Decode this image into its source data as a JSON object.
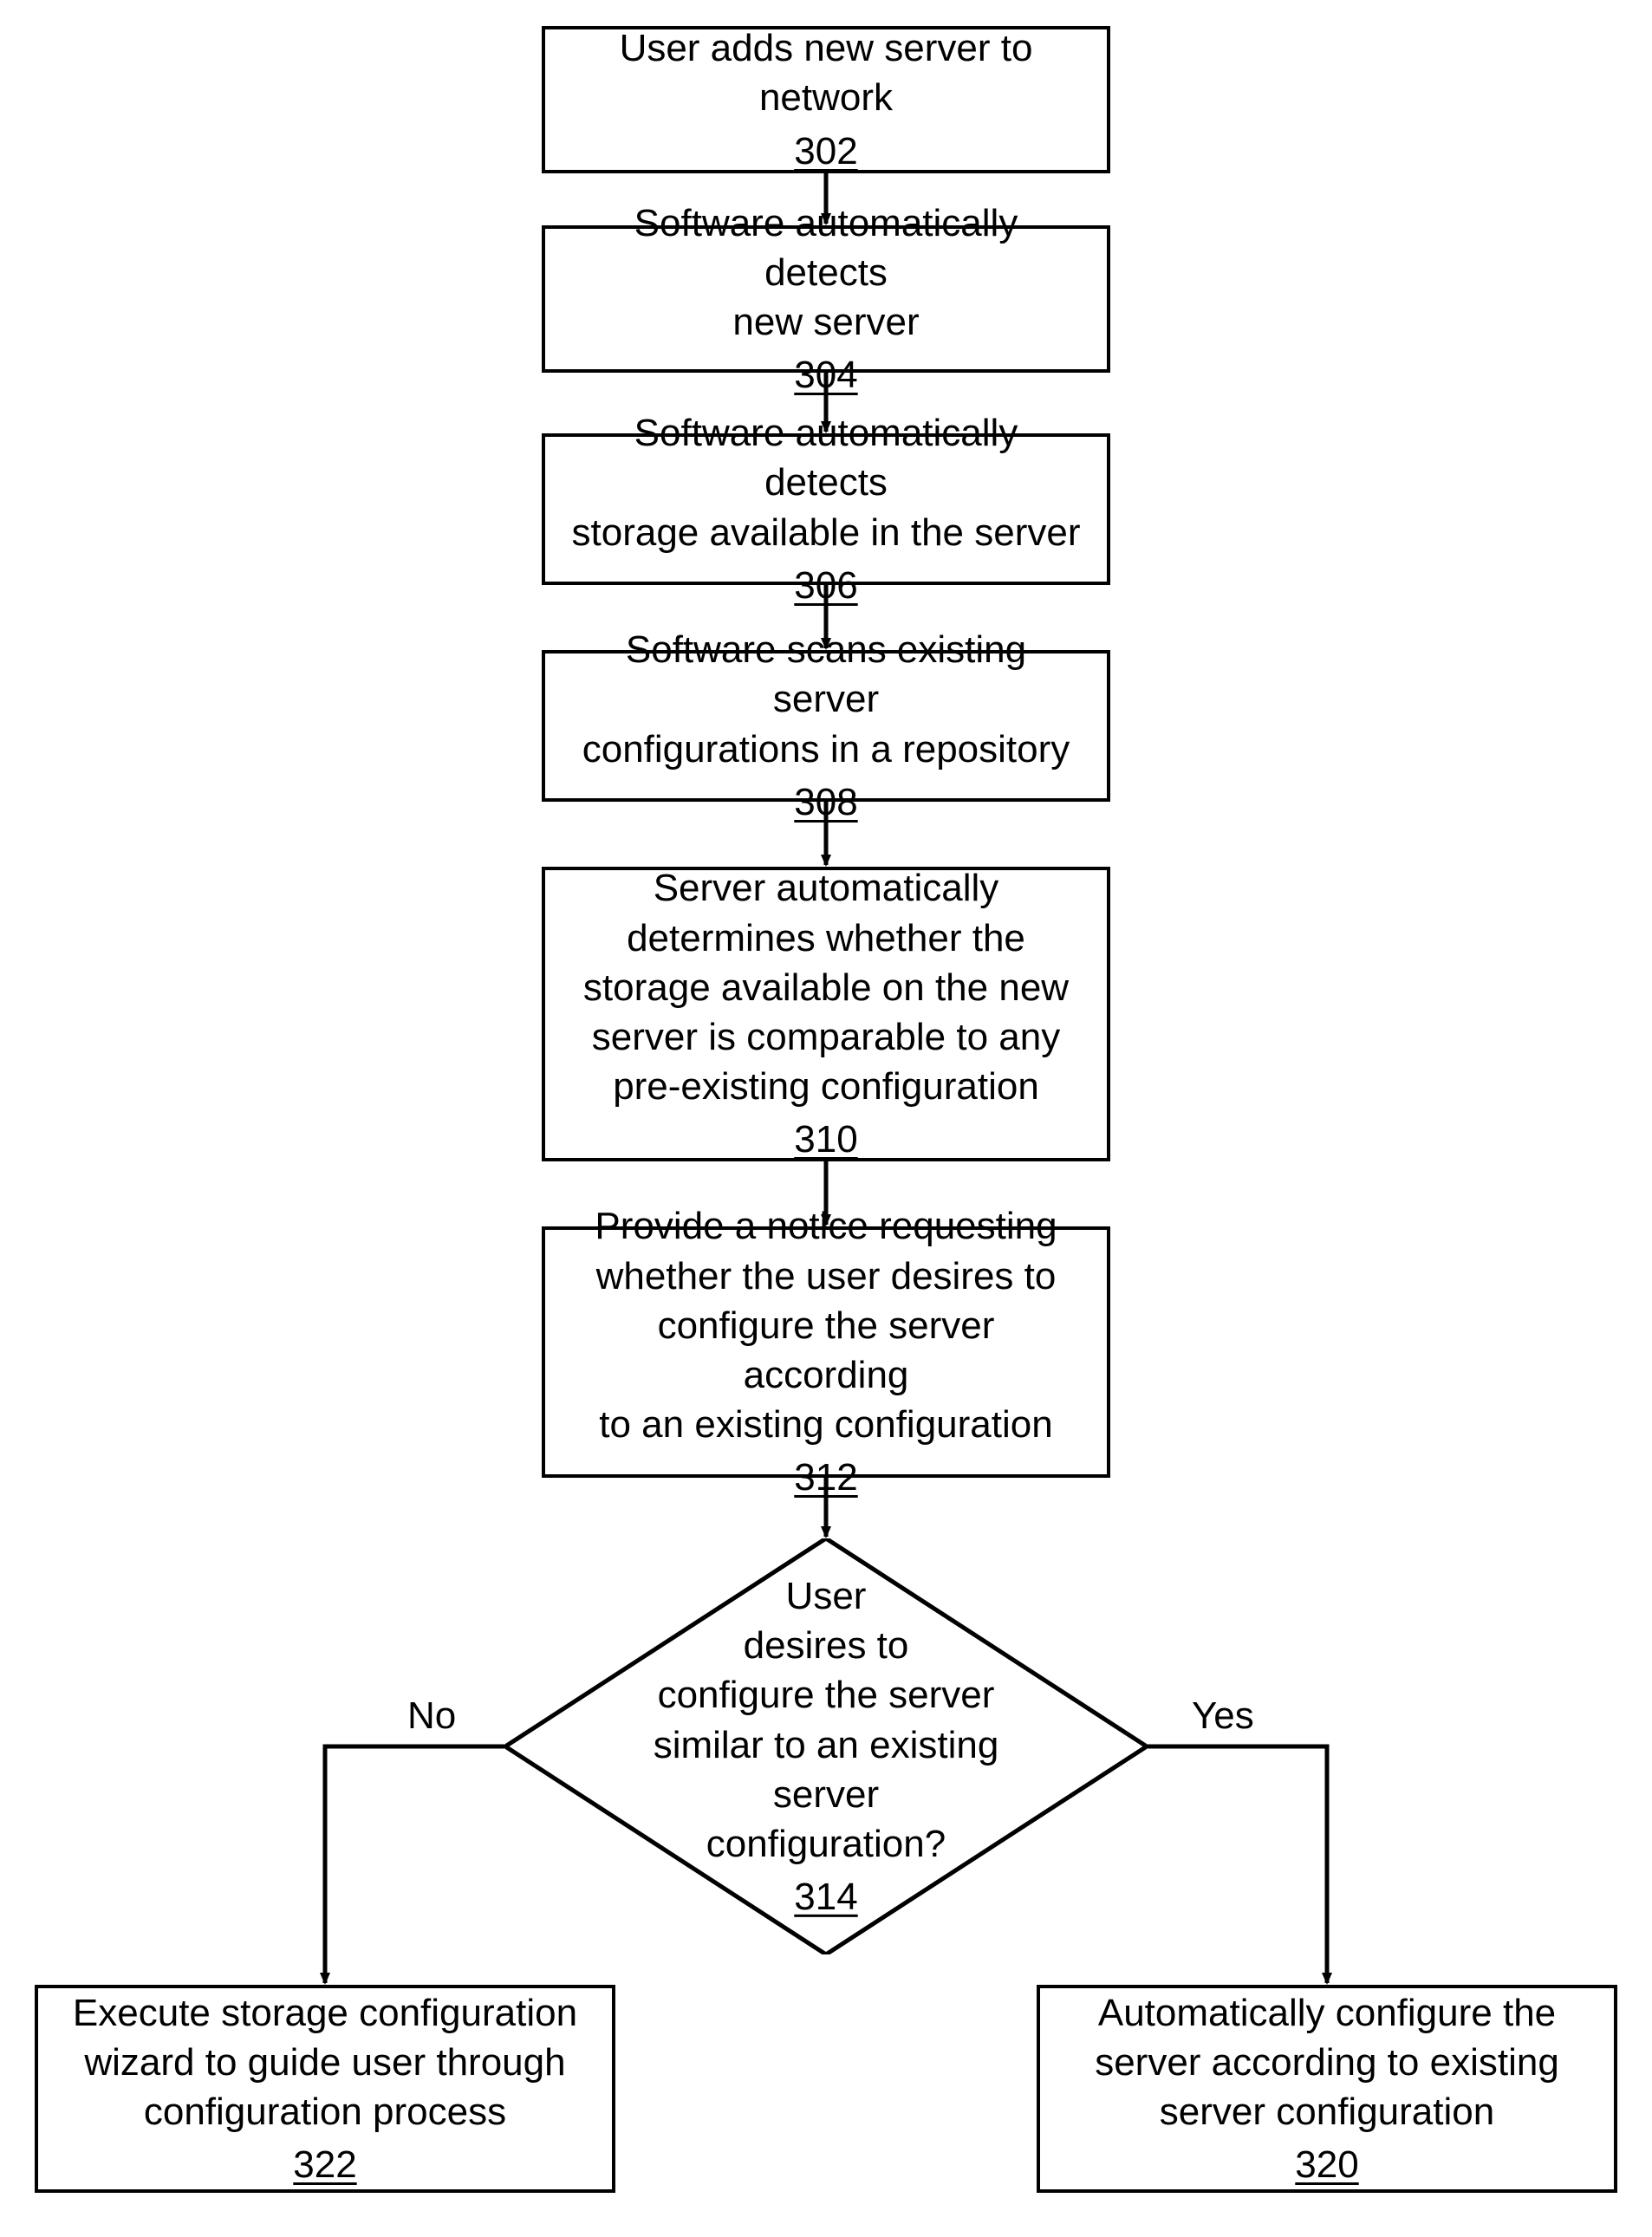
{
  "nodes": {
    "n302": {
      "text": "User adds new server to\nnetwork",
      "num": "302"
    },
    "n304": {
      "text": "Software automatically detects\nnew server",
      "num": "304"
    },
    "n306": {
      "text": "Software automatically detects\nstorage available in the server",
      "num": "306"
    },
    "n308": {
      "text": "Software scans existing server\nconfigurations in a repository",
      "num": "308"
    },
    "n310": {
      "text": "Server automatically\ndetermines whether the\nstorage available on the new\nserver is comparable to any\npre-existing configuration",
      "num": "310"
    },
    "n312": {
      "text": "Provide a notice requesting\nwhether the user desires to\nconfigure the server according\nto an existing configuration",
      "num": "312"
    },
    "d314": {
      "text": "User\ndesires to\nconfigure the server\nsimilar to an existing server\nconfiguration?",
      "num": "314"
    },
    "n322": {
      "text": "Execute storage configuration\nwizard to guide user through\nconfiguration process",
      "num": "322"
    },
    "n320": {
      "text": "Automatically configure the\nserver according to existing\nserver configuration",
      "num": "320"
    }
  },
  "labels": {
    "no": "No",
    "yes": "Yes"
  },
  "chart_data": {
    "type": "flowchart",
    "nodes": [
      {
        "id": "302",
        "type": "process",
        "text": "User adds new server to network"
      },
      {
        "id": "304",
        "type": "process",
        "text": "Software automatically detects new server"
      },
      {
        "id": "306",
        "type": "process",
        "text": "Software automatically detects storage available in the server"
      },
      {
        "id": "308",
        "type": "process",
        "text": "Software scans existing server configurations in a repository"
      },
      {
        "id": "310",
        "type": "process",
        "text": "Server automatically determines whether the storage available on the new server is comparable to any pre-existing configuration"
      },
      {
        "id": "312",
        "type": "process",
        "text": "Provide a notice requesting whether the user desires to configure the server according to an existing configuration"
      },
      {
        "id": "314",
        "type": "decision",
        "text": "User desires to configure the server similar to an existing server configuration?"
      },
      {
        "id": "322",
        "type": "process",
        "text": "Execute storage configuration wizard to guide user through configuration process"
      },
      {
        "id": "320",
        "type": "process",
        "text": "Automatically configure the server according to existing server configuration"
      }
    ],
    "edges": [
      {
        "from": "302",
        "to": "304"
      },
      {
        "from": "304",
        "to": "306"
      },
      {
        "from": "306",
        "to": "308"
      },
      {
        "from": "308",
        "to": "310"
      },
      {
        "from": "310",
        "to": "312"
      },
      {
        "from": "312",
        "to": "314"
      },
      {
        "from": "314",
        "to": "322",
        "label": "No"
      },
      {
        "from": "314",
        "to": "320",
        "label": "Yes"
      }
    ]
  }
}
